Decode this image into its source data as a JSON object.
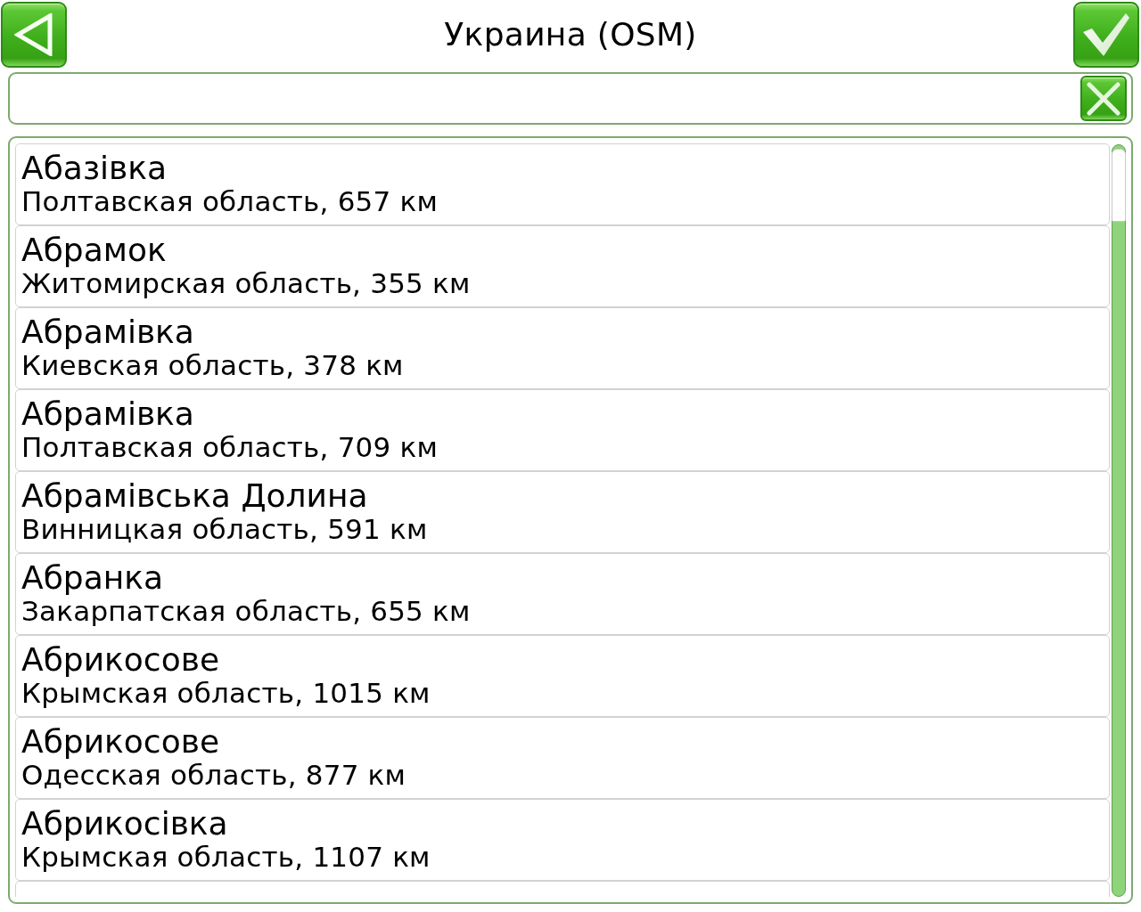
{
  "header": {
    "title": "Украина (OSM)"
  },
  "results": [
    {
      "kind": "full",
      "name": "Абазівка",
      "detail": "Полтавская область, 657 км"
    },
    {
      "kind": "full",
      "name": "Абрамок",
      "detail": "Житомирская область, 355 км"
    },
    {
      "kind": "full",
      "name": "Абрамівка",
      "detail": "Киевская область, 378 км"
    },
    {
      "kind": "full",
      "name": "Абрамівка",
      "detail": "Полтавская область, 709 км"
    },
    {
      "kind": "full",
      "name": "Абрамівська Долина",
      "detail": "Винницкая область, 591 км"
    },
    {
      "kind": "full",
      "name": "Абранка",
      "detail": "Закарпатская область, 655 км"
    },
    {
      "kind": "full",
      "name": "Абрикосове",
      "detail": "Крымская область, 1015 км"
    },
    {
      "kind": "full",
      "name": "Абрикосове",
      "detail": "Одесская область, 877 км"
    },
    {
      "kind": "full",
      "name": "Абрикосівка",
      "detail": "Крымская область, 1107 км"
    },
    {
      "kind": "cut"
    }
  ]
}
